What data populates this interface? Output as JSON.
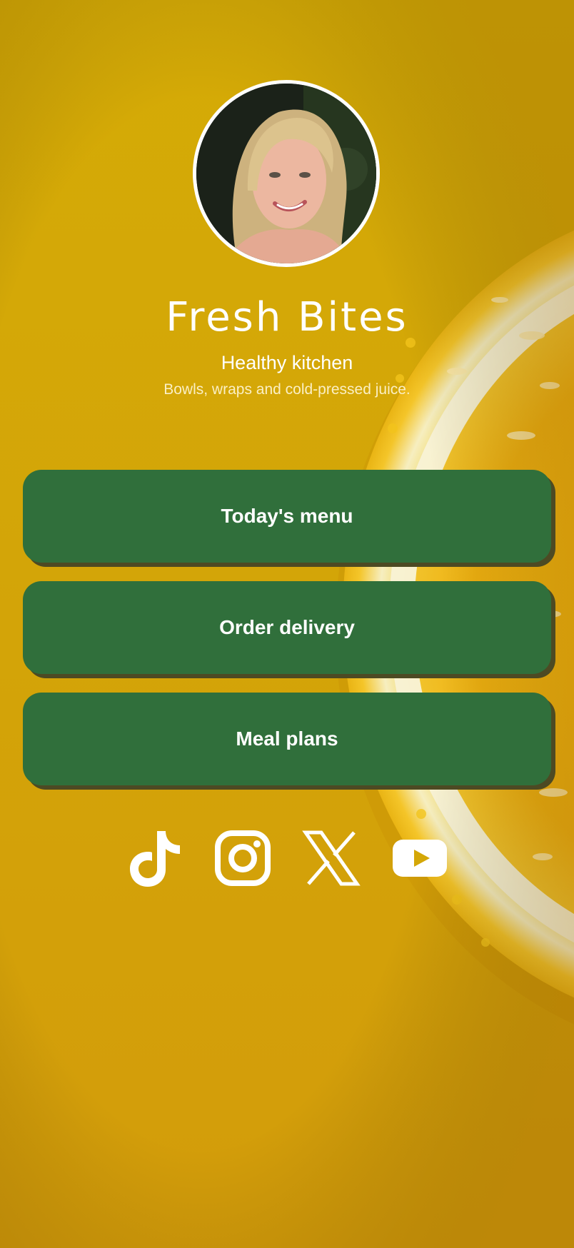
{
  "profile": {
    "name": "Fresh Bites",
    "subtitle": "Healthy kitchen",
    "tagline": "Bowls, wraps and cold-pressed juice.",
    "avatar_alt": "Profile photo"
  },
  "links": [
    {
      "label": "Today's menu"
    },
    {
      "label": "Order delivery"
    },
    {
      "label": "Meal plans"
    }
  ],
  "socials": [
    {
      "icon": "tiktok-icon",
      "label": "TikTok"
    },
    {
      "icon": "instagram-icon",
      "label": "Instagram"
    },
    {
      "icon": "x-icon",
      "label": "X"
    },
    {
      "icon": "youtube-icon",
      "label": "YouTube"
    }
  ],
  "colors": {
    "background": "#d4a707",
    "button": "#306f3b",
    "button_shadow": "#4d4a23",
    "text": "#ffffff"
  }
}
